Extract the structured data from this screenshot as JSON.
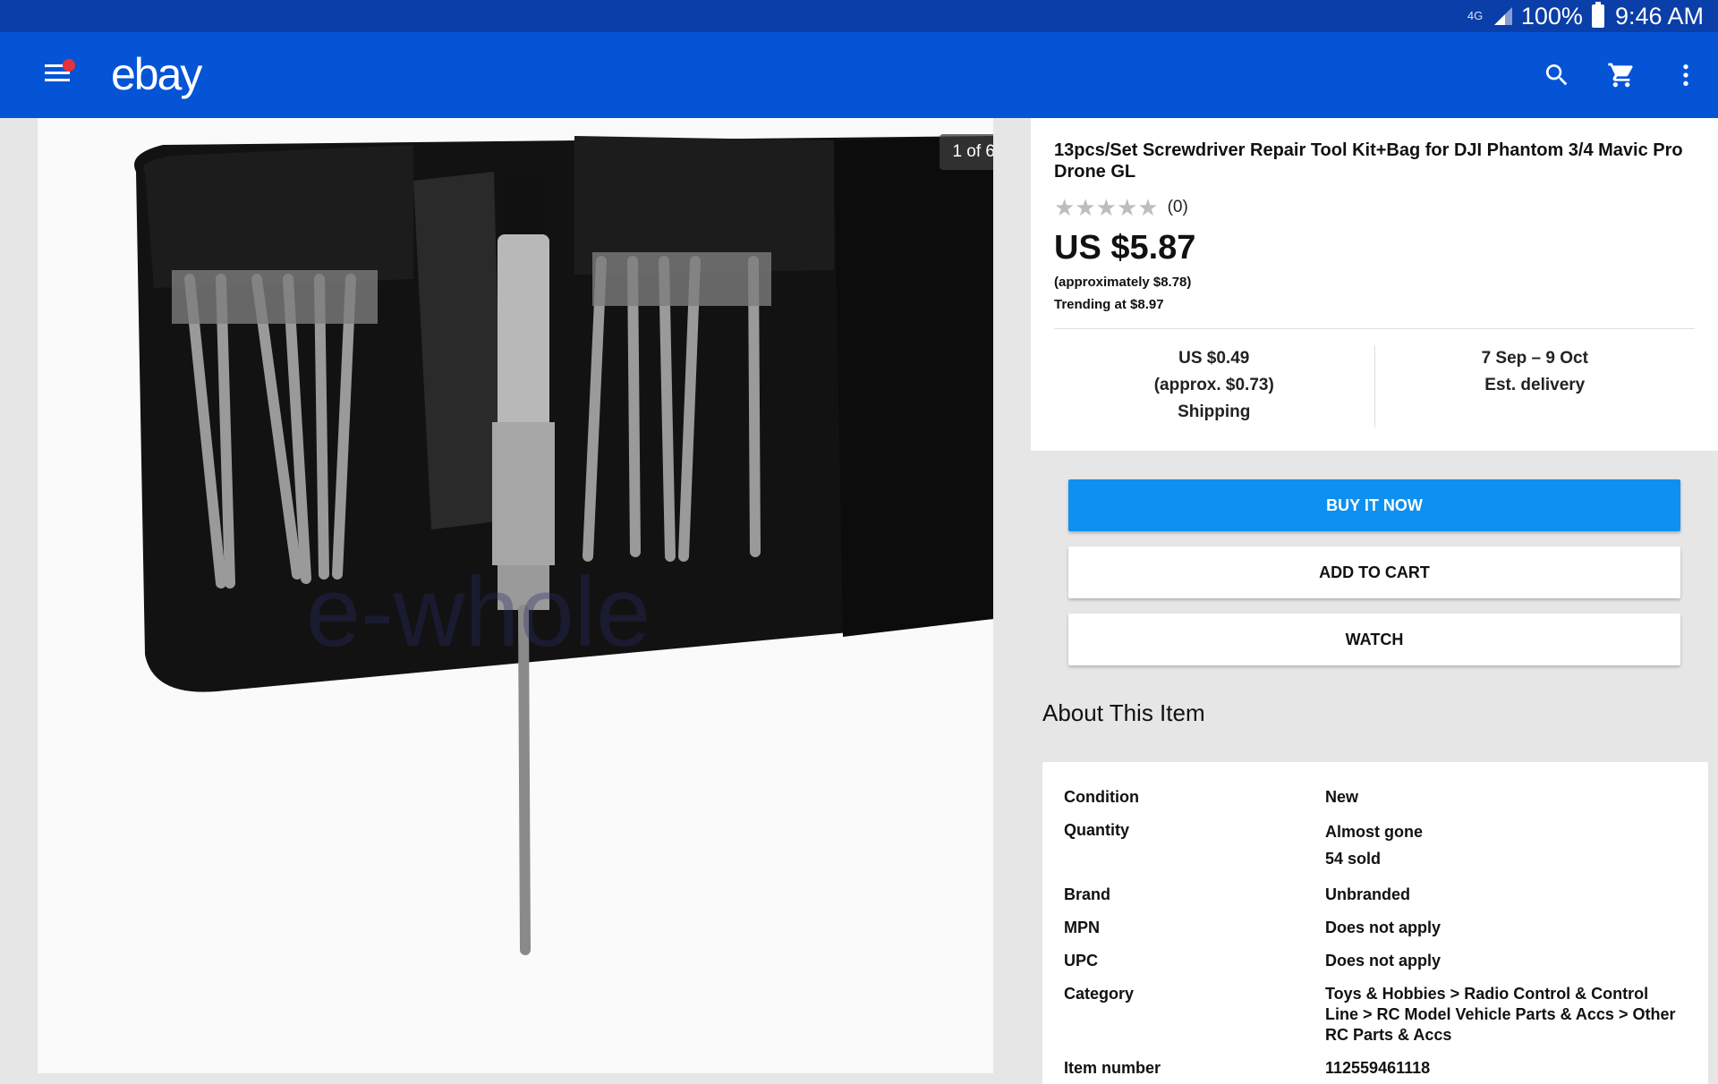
{
  "status_bar": {
    "network": "4G",
    "battery": "100%",
    "time": "9:46 AM"
  },
  "app_bar": {
    "logo": "ebay",
    "icons": [
      "menu-icon",
      "search-icon",
      "cart-icon",
      "more-vert-icon"
    ],
    "brand_color": "#0654d6",
    "notification_color": "#e53238"
  },
  "gallery": {
    "counter": "1 of 6",
    "watermark": "e-whole"
  },
  "item": {
    "title": "13pcs/Set Screwdriver Repair Tool Kit+Bag for DJI Phantom 3/4 Mavic Pro Drone GL",
    "rating_stars": 0,
    "rating_count": "(0)",
    "price": "US $5.87",
    "approx_price": "(approximately $8.78)",
    "trending": "Trending at $8.97"
  },
  "shipping": {
    "cost": "US $0.49",
    "cost_approx": "(approx. $0.73)",
    "cost_label": "Shipping",
    "delivery_dates": "7 Sep – 9 Oct",
    "delivery_label": "Est. delivery"
  },
  "actions": {
    "buy_now": "BUY IT NOW",
    "add_to_cart": "ADD TO CART",
    "watch": "WATCH",
    "primary_color": "#0e90f0"
  },
  "about": {
    "heading": "About This Item",
    "specs": [
      {
        "key": "Condition",
        "value": [
          "New"
        ]
      },
      {
        "key": "Quantity",
        "value": [
          "Almost gone",
          "54 sold"
        ]
      },
      {
        "key": "Brand",
        "value": [
          "Unbranded"
        ]
      },
      {
        "key": "MPN",
        "value": [
          "Does not apply"
        ]
      },
      {
        "key": "UPC",
        "value": [
          "Does not apply"
        ]
      },
      {
        "key": "Category",
        "value": [
          "Toys & Hobbies > Radio Control & Control Line > RC Model Vehicle Parts & Accs > Other RC Parts & Accs"
        ]
      },
      {
        "key": "Item number",
        "value": [
          "112559461118"
        ]
      }
    ]
  }
}
